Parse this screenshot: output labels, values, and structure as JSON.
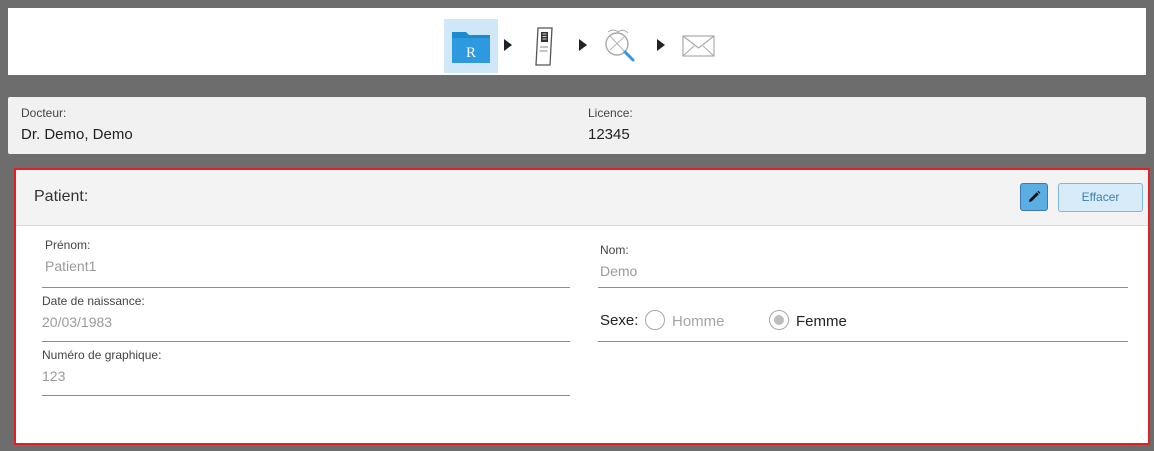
{
  "workflow": {
    "steps": [
      {
        "name": "rx-folder",
        "letter": "R",
        "active": true
      },
      {
        "name": "scanner",
        "active": false
      },
      {
        "name": "view-search",
        "active": false
      },
      {
        "name": "send-mail",
        "active": false
      }
    ]
  },
  "doctor_panel": {
    "doctor_label": "Docteur:",
    "doctor_value": "Dr. Demo, Demo",
    "license_label": "Licence:",
    "license_value": "12345"
  },
  "patient_panel": {
    "title": "Patient:",
    "edit_icon": "pencil-icon",
    "clear_label": "Effacer",
    "first_name_label": "Prénom:",
    "first_name_value": "Patient1",
    "last_name_label": "Nom:",
    "last_name_value": "Demo",
    "dob_label": "Date de naissance:",
    "dob_value": "20/03/1983",
    "chart_label": "Numéro de graphique:",
    "chart_value": "123",
    "sex_label": "Sexe:",
    "sex_options": [
      "Homme",
      "Femme"
    ],
    "sex_selected": "Femme"
  },
  "colors": {
    "accent": "#5aaee3",
    "highlight_border": "#e02027",
    "active_step_bg": "#cfe7f6"
  }
}
